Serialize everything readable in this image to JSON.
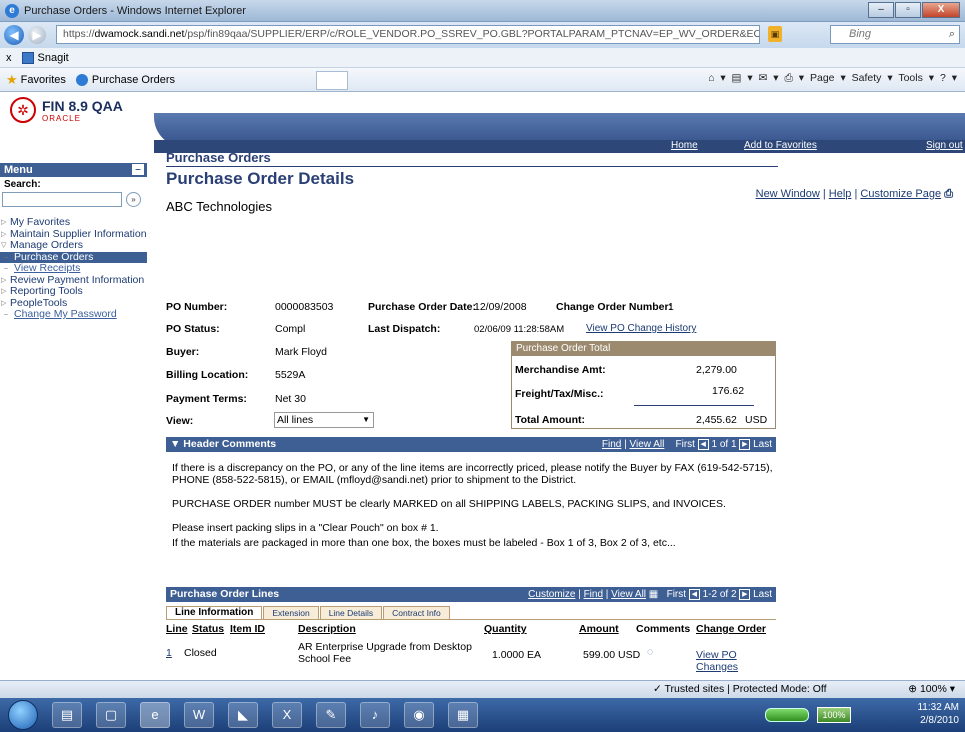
{
  "browser": {
    "title": "Purchase Orders - Windows Internet Explorer",
    "url_prefix": "https://",
    "url_domain": "dwamock.sandi.net",
    "url_path": "/psp/fin89qaa/SUPPLIER/ERP/c/ROLE_VENDOR.PO_SSREV_PO.GBL?PORTALPARAM_PTCNAV=EP_WV_ORDER&EO",
    "search_placeholder": "Bing",
    "toolbar_x": "x",
    "snagit_label": "Snagit",
    "favorites_label": "Favorites",
    "tab_label": "Purchase Orders",
    "cmd_page": "Page ▾",
    "cmd_safety": "Safety ▾",
    "cmd_tools": "Tools ▾",
    "status_zone": "✓ Trusted sites | Protected Mode: Off",
    "zoom": "100%"
  },
  "app": {
    "logo_title": "FIN 8.9 QAA",
    "logo_sub": "ORACLE",
    "top_links": {
      "home": "Home",
      "add_favorites": "Add to Favorites",
      "sign_out": "Sign out"
    },
    "right_links": {
      "new_window": "New Window",
      "help": "Help",
      "customize": "Customize Page"
    }
  },
  "menu": {
    "header": "Menu",
    "search_label": "Search:",
    "items": [
      {
        "label": "My Favorites"
      },
      {
        "label": "Maintain Supplier Information"
      },
      {
        "label": "Manage Orders"
      },
      {
        "label": "Purchase Orders"
      },
      {
        "label": "View Receipts"
      },
      {
        "label": "Review Payment Information"
      },
      {
        "label": "Reporting Tools"
      },
      {
        "label": "PeopleTools"
      },
      {
        "label": "Change My Password"
      }
    ]
  },
  "page": {
    "breadcrumb": "Purchase Orders",
    "title": "Purchase Order Details",
    "company": "ABC Technologies",
    "fields": {
      "po_number_label": "PO Number:",
      "po_number": "0000083503",
      "po_date_label": "Purchase Order Date:",
      "po_date": "12/09/2008",
      "change_no_label": "Change Order Number:",
      "change_no": "1",
      "po_status_label": "PO Status:",
      "po_status": "Compl",
      "last_dispatch_label": "Last Dispatch:",
      "last_dispatch": "02/06/09 11:28:58AM",
      "view_history": "View PO Change History",
      "buyer_label": "Buyer:",
      "buyer": "Mark Floyd",
      "billing_label": "Billing Location:",
      "billing": "5529A",
      "terms_label": "Payment Terms:",
      "terms": "Net 30",
      "view_label": "View:",
      "view_value": "All lines"
    },
    "totals": {
      "header": "Purchase Order Total",
      "merch_label": "Merchandise Amt:",
      "merch": "2,279.00",
      "freight_label": "Freight/Tax/Misc.:",
      "freight": "176.62",
      "total_label": "Total Amount:",
      "total": "2,455.62",
      "currency": "USD"
    },
    "header_comments": {
      "band": "▼ Header Comments",
      "find": "Find",
      "view_all": "View All",
      "first": "First",
      "pager": "1 of 1",
      "last": "Last",
      "paragraphs": [
        "If there is a discrepancy on the PO, or any of the line items are incorrectly priced, please notify the Buyer by FAX (619-542-5715), PHONE (858-522-5815), or EMAIL (mfloyd@sandi.net) prior to shipment to the District.",
        "PURCHASE ORDER number MUST be clearly MARKED on all SHIPPING LABELS, PACKING SLIPS, and INVOICES.",
        "Please insert packing slips in a \"Clear Pouch\" on box # 1.",
        "If the materials are packaged in more than one box, the boxes must be labeled - Box 1 of 3, Box 2 of 3, etc..."
      ]
    },
    "lines": {
      "band": "Purchase Order Lines",
      "customize": "Customize",
      "find": "Find",
      "view_all": "View All",
      "first": "First",
      "pager": "1-2 of 2",
      "last": "Last",
      "tabs": [
        "Line Information",
        "Extension",
        "Line Details",
        "Contract Info"
      ],
      "columns": {
        "line": "Line",
        "status": "Status",
        "item": "Item ID",
        "desc": "Description",
        "qty": "Quantity",
        "amount": "Amount",
        "comments": "Comments",
        "change": "Change Order"
      },
      "rows": [
        {
          "line": "1",
          "status": "Closed",
          "item": "",
          "desc1": "AR Enterprise Upgrade from Desktop",
          "desc2": "School Fee",
          "qty": "1.0000 EA",
          "amount": "599.00 USD",
          "change": "View PO Changes"
        }
      ]
    }
  },
  "taskbar": {
    "time": "11:32 AM",
    "date": "2/8/2010",
    "battery": "100%"
  }
}
